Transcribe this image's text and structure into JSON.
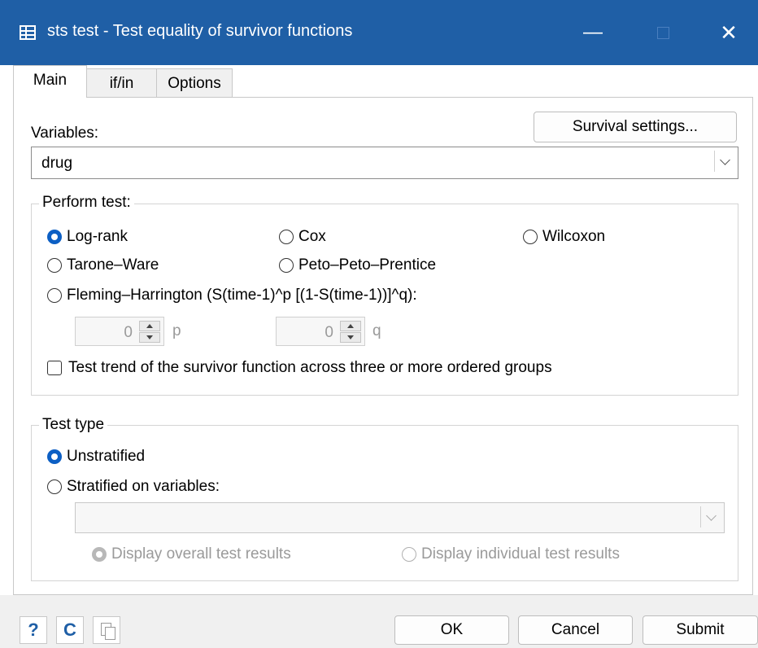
{
  "window": {
    "title": "sts test - Test equality of survivor functions"
  },
  "tabs": [
    "Main",
    "if/in",
    "Options"
  ],
  "main": {
    "survival_settings_label": "Survival settings...",
    "variables_label": "Variables:",
    "variables_value": "drug",
    "perform_test": {
      "legend": "Perform test:",
      "options": {
        "log_rank": "Log-rank",
        "cox": "Cox",
        "wilcoxon": "Wilcoxon",
        "tarone_ware": "Tarone–Ware",
        "peto": "Peto–Peto–Prentice",
        "fleming": "Fleming–Harrington (S(time-1)^p [(1-S(time-1))]^q):"
      },
      "selected": "log_rank",
      "p_value": "0",
      "p_label": "p",
      "q_value": "0",
      "q_label": "q",
      "trend_label": "Test trend of the survivor function across three or more ordered groups",
      "trend_checked": false
    },
    "test_type": {
      "legend": "Test type",
      "unstratified": "Unstratified",
      "stratified": "Stratified on variables:",
      "selected": "unstratified",
      "strata_value": "",
      "display_overall": "Display overall test results",
      "display_individual": "Display individual test results"
    }
  },
  "footer": {
    "help_icon": "?",
    "reset_icon": "C",
    "ok_label": "OK",
    "cancel_label": "Cancel",
    "submit_label": "Submit"
  },
  "colors": {
    "titlebar": "#1f5fa6",
    "accent": "#0c5fc4"
  }
}
